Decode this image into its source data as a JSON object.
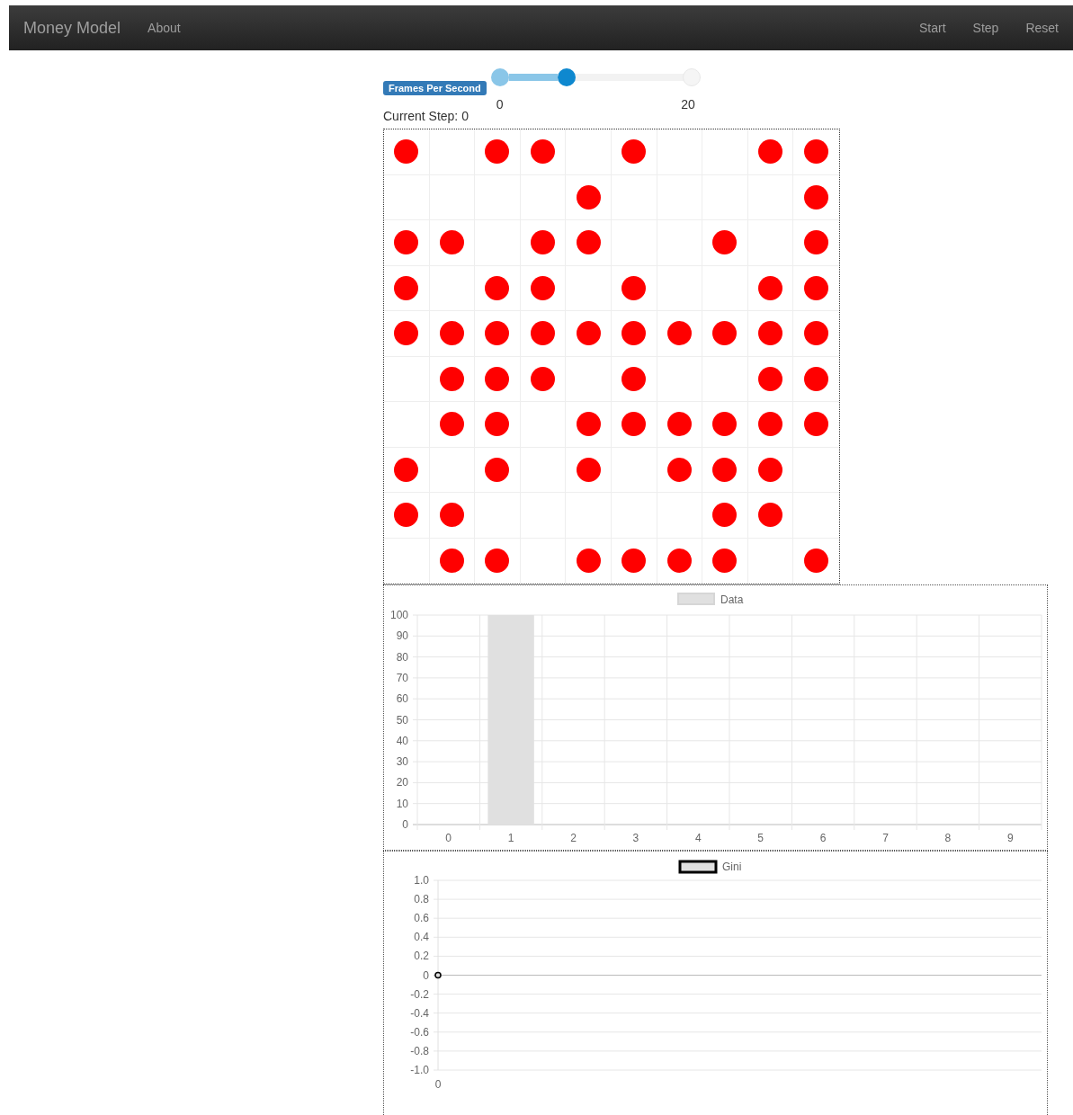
{
  "navbar": {
    "brand": "Money Model",
    "links": [
      "About"
    ],
    "controls": [
      "Start",
      "Step",
      "Reset"
    ]
  },
  "fps": {
    "label": "Frames Per Second",
    "min": "0",
    "max": "20",
    "level": 0.35
  },
  "current_step": "Current Step: 0",
  "grid": {
    "rows": [
      [
        {
          "occupied": true
        },
        {
          "occupied": false
        },
        {
          "occupied": true
        },
        {
          "occupied": true
        },
        {
          "occupied": false
        },
        {
          "occupied": true
        },
        {
          "occupied": false
        },
        {
          "occupied": false
        },
        {
          "occupied": true
        },
        {
          "occupied": true
        }
      ],
      [
        {
          "occupied": false
        },
        {
          "occupied": false
        },
        {
          "occupied": false
        },
        {
          "occupied": false
        },
        {
          "occupied": true
        },
        {
          "occupied": false
        },
        {
          "occupied": false
        },
        {
          "occupied": false
        },
        {
          "occupied": false
        },
        {
          "occupied": true
        }
      ],
      [
        {
          "occupied": true
        },
        {
          "occupied": true
        },
        {
          "occupied": false
        },
        {
          "occupied": true
        },
        {
          "occupied": true
        },
        {
          "occupied": false
        },
        {
          "occupied": false
        },
        {
          "occupied": true
        },
        {
          "occupied": false
        },
        {
          "occupied": true
        }
      ],
      [
        {
          "occupied": true
        },
        {
          "occupied": false
        },
        {
          "occupied": true
        },
        {
          "occupied": true
        },
        {
          "occupied": false
        },
        {
          "occupied": true
        },
        {
          "occupied": false
        },
        {
          "occupied": false
        },
        {
          "occupied": true
        },
        {
          "occupied": true
        }
      ],
      [
        {
          "occupied": true
        },
        {
          "occupied": true
        },
        {
          "occupied": true
        },
        {
          "occupied": true
        },
        {
          "occupied": true
        },
        {
          "occupied": true
        },
        {
          "occupied": true
        },
        {
          "occupied": true
        },
        {
          "occupied": true
        },
        {
          "occupied": true
        }
      ],
      [
        {
          "occupied": false
        },
        {
          "occupied": true
        },
        {
          "occupied": true
        },
        {
          "occupied": true
        },
        {
          "occupied": false
        },
        {
          "occupied": true
        },
        {
          "occupied": false
        },
        {
          "occupied": false
        },
        {
          "occupied": true
        },
        {
          "occupied": true
        }
      ],
      [
        {
          "occupied": false
        },
        {
          "occupied": true
        },
        {
          "occupied": true
        },
        {
          "occupied": false
        },
        {
          "occupied": true
        },
        {
          "occupied": true
        },
        {
          "occupied": true
        },
        {
          "occupied": true
        },
        {
          "occupied": true
        },
        {
          "occupied": true
        }
      ],
      [
        {
          "occupied": true
        },
        {
          "occupied": false
        },
        {
          "occupied": true
        },
        {
          "occupied": false
        },
        {
          "occupied": true
        },
        {
          "occupied": false
        },
        {
          "occupied": true
        },
        {
          "occupied": true
        },
        {
          "occupied": true
        },
        {
          "occupied": false
        }
      ],
      [
        {
          "occupied": true
        },
        {
          "occupied": true
        },
        {
          "occupied": false
        },
        {
          "occupied": false
        },
        {
          "occupied": false
        },
        {
          "occupied": false
        },
        {
          "occupied": false
        },
        {
          "occupied": true
        },
        {
          "occupied": true
        },
        {
          "occupied": false
        }
      ],
      [
        {
          "occupied": false
        },
        {
          "occupied": true
        },
        {
          "occupied": true
        },
        {
          "occupied": false
        },
        {
          "occupied": true
        },
        {
          "occupied": true
        },
        {
          "occupied": true
        },
        {
          "occupied": true
        },
        {
          "occupied": false
        },
        {
          "occupied": true
        }
      ]
    ]
  },
  "wealth_chart": {
    "chart_data": {
      "type": "bar",
      "categories": [
        "0",
        "1",
        "2",
        "3",
        "4",
        "5",
        "6",
        "7",
        "8",
        "9"
      ],
      "series": [
        {
          "name": "Data",
          "color": "#e0e0e0",
          "values": [
            0,
            100,
            0,
            0,
            0,
            0,
            0,
            0,
            0,
            0
          ]
        }
      ],
      "grid": true,
      "ylim": [
        0,
        100
      ],
      "yticks": [
        0,
        10,
        20,
        30,
        40,
        50,
        60,
        70,
        80,
        90,
        100
      ]
    }
  },
  "gini_chart": {
    "chart_data": {
      "type": "line",
      "x": [
        0
      ],
      "series": [
        {
          "name": "Gini",
          "color": "#000000",
          "marker": "circle",
          "values": [
            0
          ]
        }
      ],
      "ylim": [
        -1,
        1
      ],
      "yticks": [
        {
          "value": 1,
          "label": "1.0"
        },
        {
          "value": 0.8,
          "label": "0.8"
        },
        {
          "value": 0.6,
          "label": "0.6"
        },
        {
          "value": 0.4,
          "label": "0.4"
        },
        {
          "value": 0.2,
          "label": "0.2"
        },
        {
          "value": 0,
          "label": "0"
        },
        {
          "value": -0.2,
          "label": "-0.2"
        },
        {
          "value": -0.4,
          "label": "-0.4"
        },
        {
          "value": -0.6,
          "label": "-0.6"
        },
        {
          "value": -0.8,
          "label": "-0.8"
        },
        {
          "value": -1,
          "label": "-1.0"
        }
      ],
      "grid": true
    }
  }
}
